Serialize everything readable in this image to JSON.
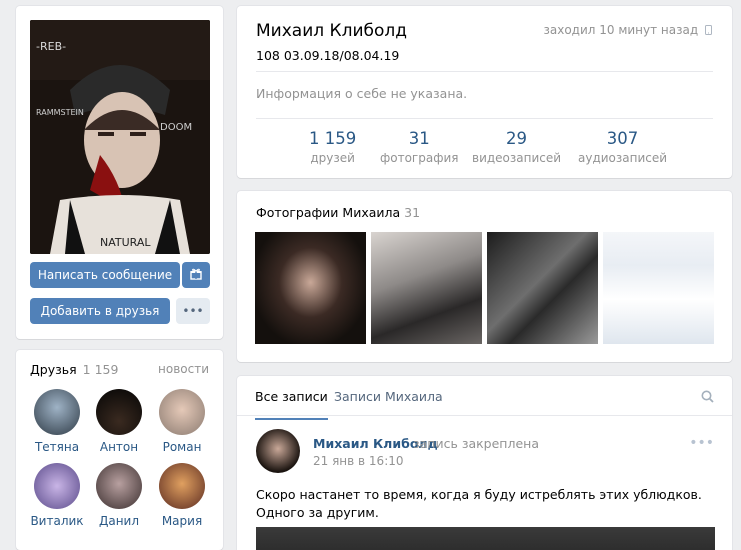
{
  "profile": {
    "name": "Михаил Клиболд",
    "status": "108 03.09.18/08.04.19",
    "online": "заходил 10 минут назад",
    "about": "Информация о себе не указана."
  },
  "actions": {
    "message": "Написать сообщение",
    "add_friend": "Добавить в друзья",
    "more": "•••"
  },
  "counters": [
    {
      "value": "1 159",
      "label": "друзей"
    },
    {
      "value": "31",
      "label": "фотография"
    },
    {
      "value": "29",
      "label": "видеозаписей"
    },
    {
      "value": "307",
      "label": "аудиозаписей"
    }
  ],
  "friends": {
    "title": "Друзья",
    "count": "1 159",
    "more": "новости",
    "items": [
      {
        "name": "Тетяна"
      },
      {
        "name": "Антон"
      },
      {
        "name": "Роман"
      },
      {
        "name": "Виталик"
      },
      {
        "name": "Данил"
      },
      {
        "name": "Мария"
      }
    ]
  },
  "photos": {
    "title": "Фотографии Михаила",
    "count": "31"
  },
  "wall": {
    "tabs": [
      "Все записи",
      "Записи Михаила"
    ],
    "post": {
      "author": "Михаил Клиболд",
      "pinned": "запись закреплена",
      "date": "21 янв в 16:10",
      "text": "Скоро настанет то время, когда я буду истреблять этих ублюдков. Одного за другим."
    }
  },
  "icons": [
    "gift-icon",
    "phone-icon",
    "search-icon",
    "dots-icon"
  ],
  "colors": {
    "accent": "#5181b8",
    "link": "#2a5885",
    "muted": "#939393",
    "bg": "#edeef0"
  }
}
